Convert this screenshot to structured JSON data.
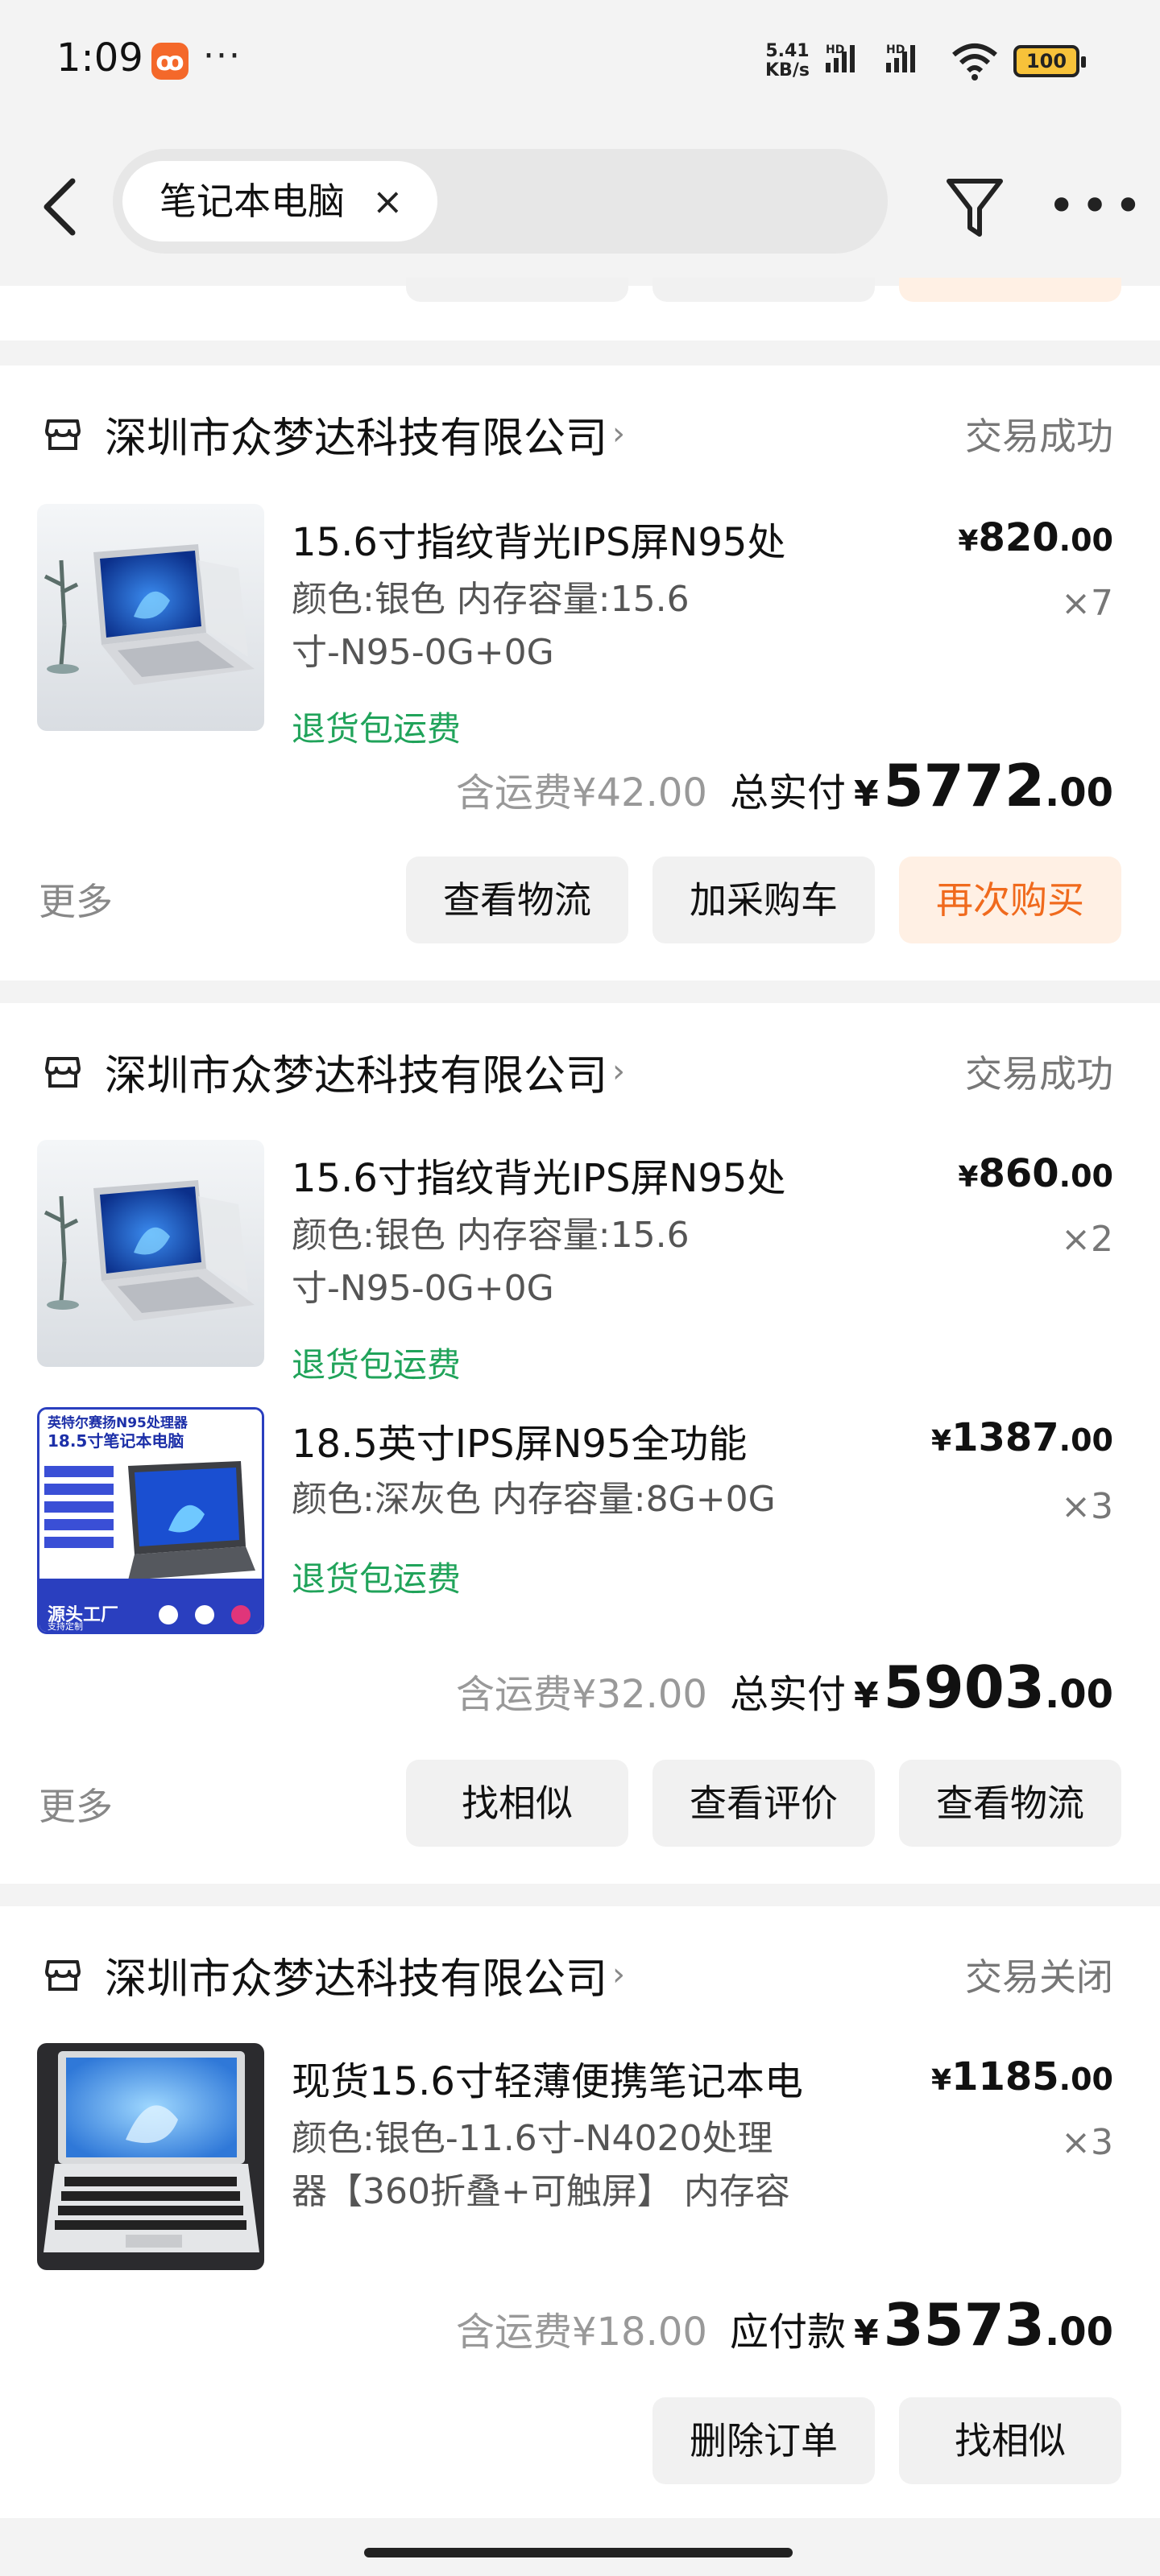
{
  "status_bar": {
    "time": "1:09",
    "app_icon": "kuaishou-icon",
    "dots": "···",
    "net_speed_value": "5.41",
    "net_speed_unit": "KB/s",
    "hd1": "HD",
    "hd2": "HD",
    "battery": "100"
  },
  "header": {
    "search_chip": "笔记本电脑",
    "chip_close": "×",
    "icons": [
      "back-arrow-icon",
      "filter-funnel-icon",
      "more-dots-icon"
    ]
  },
  "orders": [
    {
      "shop": "深圳市众梦达科技有限公司",
      "chevron": "›",
      "status": "交易成功",
      "items": [
        {
          "title": "15.6寸指纹背光IPS屏N95处",
          "spec_line1": "颜色:银色 内存容量:15.6",
          "spec_line2": "寸-N95-0G+0G",
          "return_tag": "退货包运费",
          "price_cur": "¥",
          "price_int": "820",
          "price_dec": ".00",
          "qty": "×7"
        }
      ],
      "shipping": "含运费¥42.00",
      "total_label": "总实付",
      "total_cur": "¥",
      "total_int": "5772",
      "total_dec": ".00",
      "more": "更多",
      "buttons": [
        "查看物流",
        "加采购车",
        "再次购买"
      ]
    },
    {
      "shop": "深圳市众梦达科技有限公司",
      "chevron": "›",
      "status": "交易成功",
      "items": [
        {
          "title": "15.6寸指纹背光IPS屏N95处",
          "spec_line1": "颜色:银色 内存容量:15.6",
          "spec_line2": "寸-N95-0G+0G",
          "return_tag": "退货包运费",
          "price_cur": "¥",
          "price_int": "860",
          "price_dec": ".00",
          "qty": "×2"
        },
        {
          "title": "18.5英寸IPS屏N95全功能",
          "spec_line1": "颜色:深灰色 内存容量:8G+0G",
          "return_tag": "退货包运费",
          "price_cur": "¥",
          "price_int": "1387",
          "price_dec": ".00",
          "qty": "×3",
          "thumb_text_top": "英特尔赛扬N95处理器",
          "thumb_text_title": "18.5寸笔记本电脑",
          "thumb_text_factory": "源头工厂",
          "thumb_text_custom": "支持定制"
        }
      ],
      "shipping": "含运费¥32.00",
      "total_label": "总实付",
      "total_cur": "¥",
      "total_int": "5903",
      "total_dec": ".00",
      "more": "更多",
      "buttons": [
        "找相似",
        "查看评价",
        "查看物流"
      ]
    },
    {
      "shop": "深圳市众梦达科技有限公司",
      "chevron": "›",
      "status": "交易关闭",
      "items": [
        {
          "title": "现货15.6寸轻薄便携笔记本电",
          "spec_line1": "颜色:银色-11.6寸-N4020处理",
          "spec_line2": "器【360折叠+可触屏】 内存容",
          "price_cur": "¥",
          "price_int": "1185",
          "price_dec": ".00",
          "qty": "×3"
        }
      ],
      "shipping": "含运费¥18.00",
      "total_label": "应付款",
      "total_cur": "¥",
      "total_int": "3573",
      "total_dec": ".00",
      "buttons": [
        "删除订单",
        "找相似"
      ]
    }
  ],
  "colors": {
    "accent_orange": "#f06a1d",
    "return_green": "#20a35a",
    "background": "#f3f3f3"
  }
}
